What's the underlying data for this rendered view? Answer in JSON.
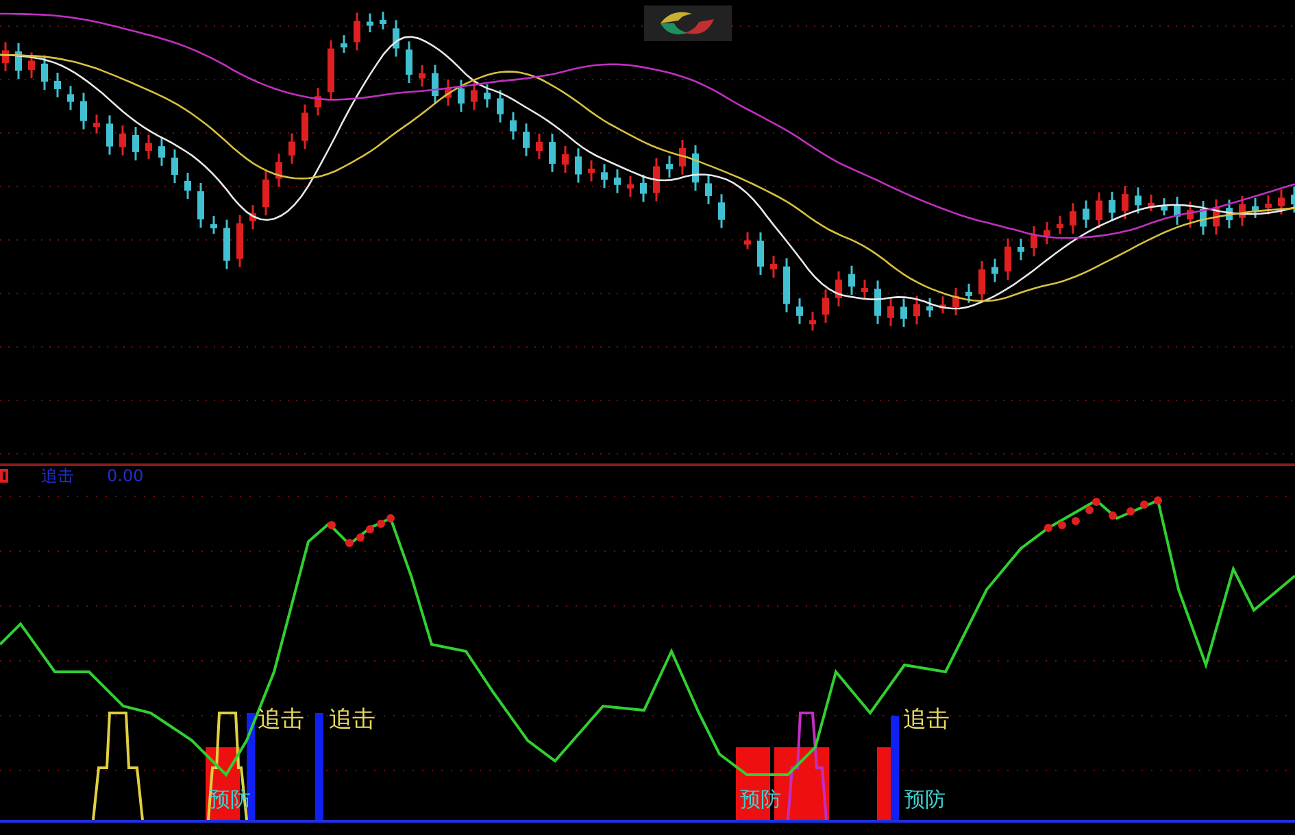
{
  "indicator_header": {
    "name": "追击",
    "value": "0.00"
  },
  "signals": [
    {
      "kind": "chase",
      "label": "追击"
    },
    {
      "kind": "chase",
      "label": "追击"
    },
    {
      "kind": "chase",
      "label": "追击"
    },
    {
      "kind": "warn",
      "label": "预防"
    },
    {
      "kind": "warn",
      "label": "预防"
    },
    {
      "kind": "warn",
      "label": "预防"
    }
  ]
}
